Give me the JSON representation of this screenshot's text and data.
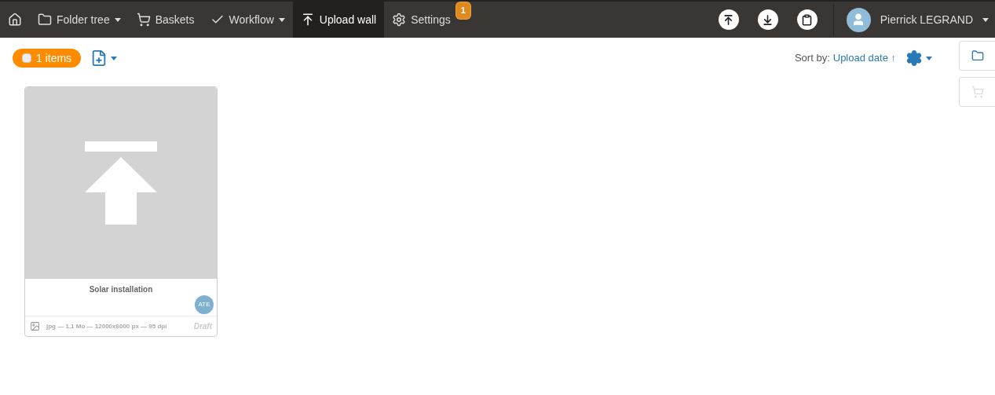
{
  "nav": {
    "items": [
      {
        "kind": "home",
        "selected": false
      },
      {
        "kind": "folder",
        "label": "Folder tree",
        "dropdown": true,
        "selected": false
      },
      {
        "kind": "cart",
        "label": "Baskets",
        "dropdown": false,
        "selected": false
      },
      {
        "kind": "check",
        "label": "Workflow",
        "dropdown": true,
        "selected": false
      },
      {
        "kind": "upload",
        "label": "Upload wall",
        "dropdown": false,
        "selected": true
      },
      {
        "kind": "gear",
        "label": "Settings",
        "dropdown": false,
        "selected": false,
        "badge": "1"
      }
    ],
    "actions": [
      {
        "kind": "upload"
      },
      {
        "kind": "download"
      },
      {
        "kind": "clipboard"
      }
    ],
    "user": {
      "name": "Pierrick LEGRAND"
    }
  },
  "toolbar": {
    "select_all": {
      "label": "1 items",
      "checked": false
    },
    "sort_label": "Sort by:",
    "sort_value": "Upload date",
    "sort_direction": "↑"
  },
  "side_buttons": [
    {
      "kind": "folder",
      "disabled": false
    },
    {
      "kind": "cart",
      "disabled": true
    }
  ],
  "cards": [
    {
      "title": "Solar installation",
      "owner": "ATE",
      "meta": "jpg — 1.1 Mo — 12000x6000 px — 95 dpi",
      "status": "Draft"
    }
  ]
}
